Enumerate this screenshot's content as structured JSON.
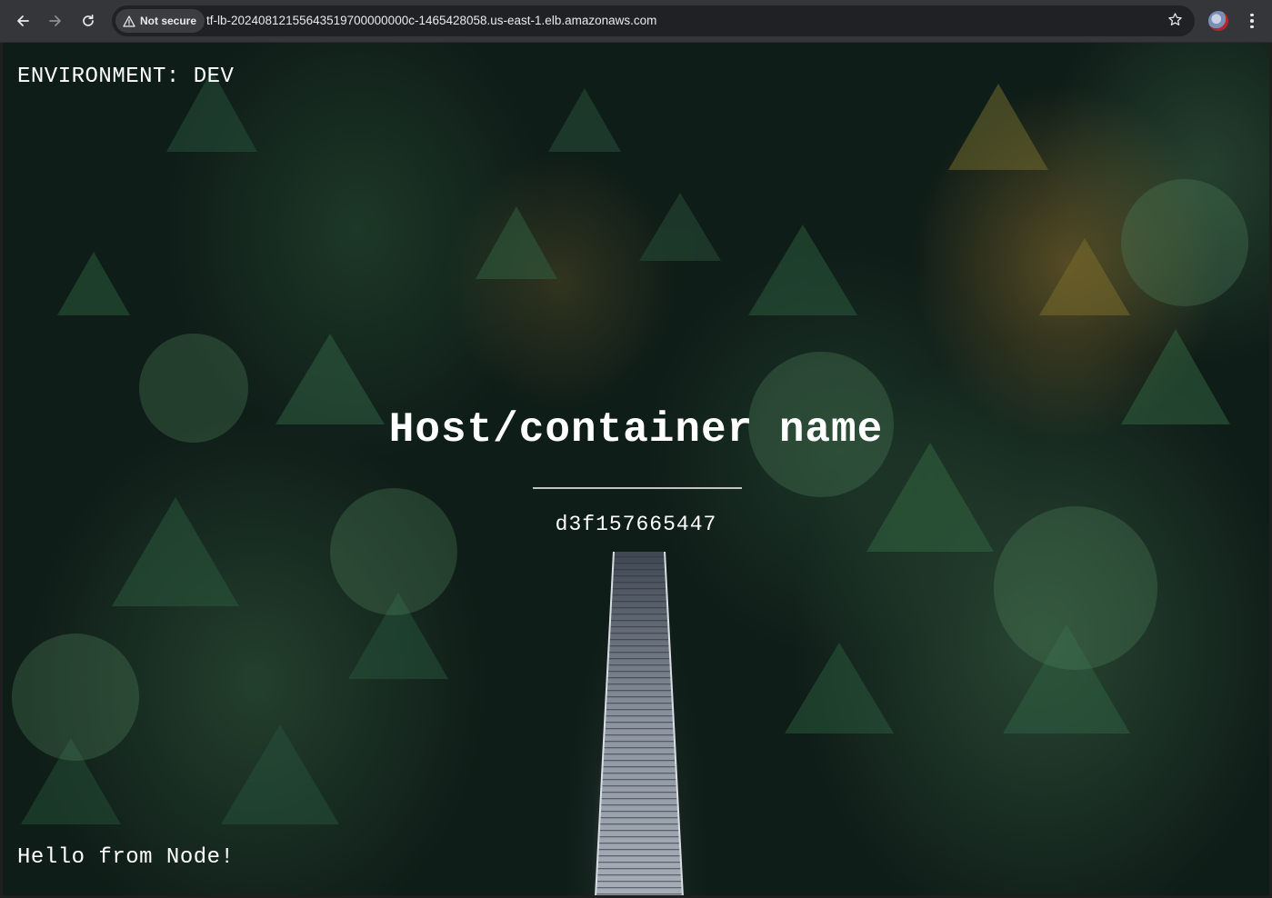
{
  "browser": {
    "back_icon": "arrow-left-icon",
    "forward_icon": "arrow-right-icon",
    "reload_icon": "reload-icon",
    "security_label": "Not secure",
    "security_icon": "warning-triangle-icon",
    "url": "tf-lb-20240812155643519700000000c-1465428058.us-east-1.elb.amazonaws.com",
    "bookmark_icon": "star-icon",
    "menu_icon": "kebab-menu-icon"
  },
  "page": {
    "environment_label": "ENVIRONMENT: DEV",
    "title": "Host/container name",
    "hostname": "d3f157665447",
    "footer_message": "Hello from Node!"
  },
  "colors": {
    "toolbar": "#35363a",
    "omnibox": "#202124",
    "page_text": "#ffffff",
    "forest_dark": "#0f1d18"
  }
}
